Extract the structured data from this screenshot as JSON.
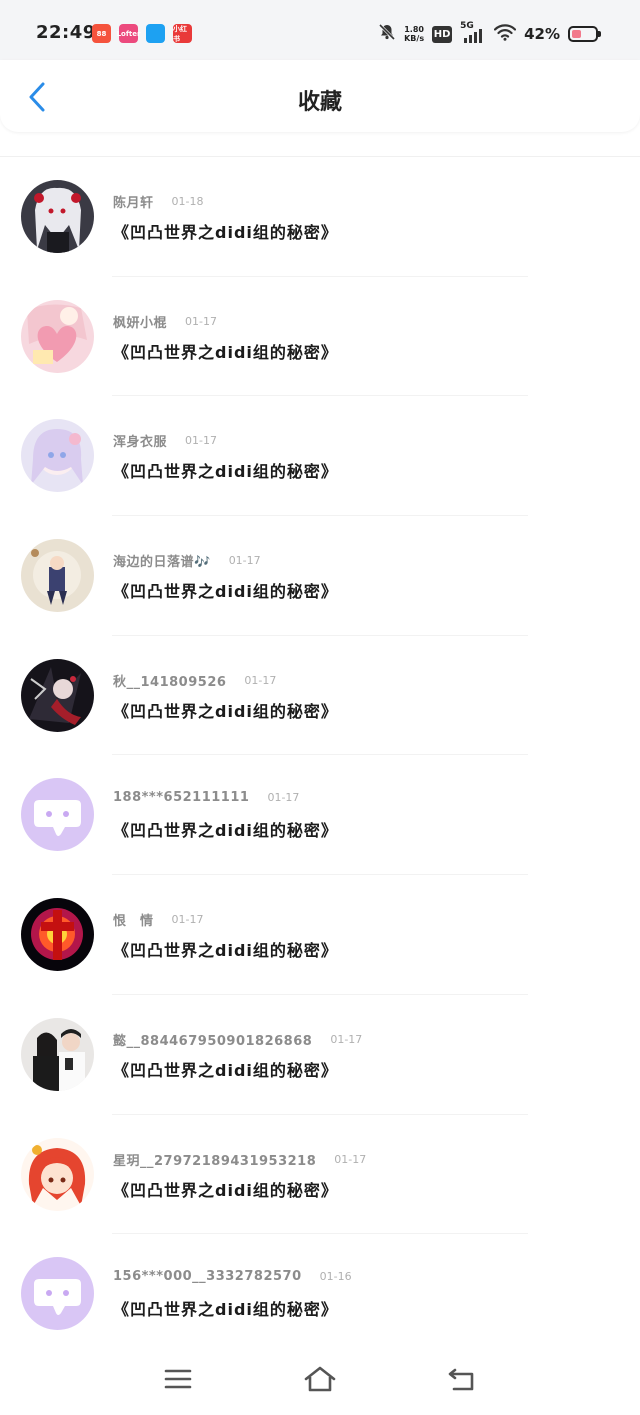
{
  "status_bar": {
    "time": "22:49",
    "net_speed_value": "1.80",
    "net_speed_unit": "KB/s",
    "hd_label": "HD",
    "network_type": "5G",
    "battery_text": "42%",
    "battery_level": 0.42,
    "app_badges": [
      {
        "name": "app-badge-1",
        "color": "#f5533d",
        "label": "88"
      },
      {
        "name": "app-badge-2",
        "color": "#ec4a7e",
        "label": "Lofter"
      },
      {
        "name": "app-badge-3",
        "color": "#1da1f2",
        "label": ""
      },
      {
        "name": "app-badge-4",
        "color": "#e93a3a",
        "label": "小红书"
      }
    ]
  },
  "header": {
    "title": "收藏",
    "back_icon": "chevron-left-icon",
    "accent_color": "#2a8ce8"
  },
  "items": [
    {
      "username": "陈月轩",
      "date": "01-18",
      "title": "《凹凸世界之didi组的秘密》",
      "avatar": "anime-white-hair"
    },
    {
      "username": "枫妍小棍",
      "date": "01-17",
      "title": "《凹凸世界之didi组的秘密》",
      "avatar": "pink-heart"
    },
    {
      "username": "浑身衣服",
      "date": "01-17",
      "title": "《凹凸世界之didi组的秘密》",
      "avatar": "anime-pastel"
    },
    {
      "username": "海边的日落谱🎶",
      "date": "01-17",
      "title": "《凹凸世界之didi组的秘密》",
      "avatar": "doll-beige"
    },
    {
      "username": "秋__141809526",
      "date": "01-17",
      "title": "《凹凸世界之didi组的秘密》",
      "avatar": "dark-art"
    },
    {
      "username": "188***652111111",
      "date": "01-17",
      "title": "《凹凸世界之didi组的秘密》",
      "avatar": "default-chat"
    },
    {
      "username": "恨　情",
      "date": "01-17",
      "title": "《凹凸世界之didi组的秘密》",
      "avatar": "red-cross"
    },
    {
      "username": "懿__884467950901826868",
      "date": "01-17",
      "title": "《凹凸世界之didi组的秘密》",
      "avatar": "couple-photo"
    },
    {
      "username": "星玥__27972189431953218",
      "date": "01-17",
      "title": "《凹凸世界之didi组的秘密》",
      "avatar": "anime-red-hair"
    },
    {
      "username": "156***000__3332782570",
      "date": "01-16",
      "title": "《凹凸世界之didi组的秘密》",
      "avatar": "default-chat"
    }
  ],
  "nav_bar": {
    "buttons": [
      "menu-icon",
      "home-icon",
      "back-arrow-icon"
    ]
  }
}
